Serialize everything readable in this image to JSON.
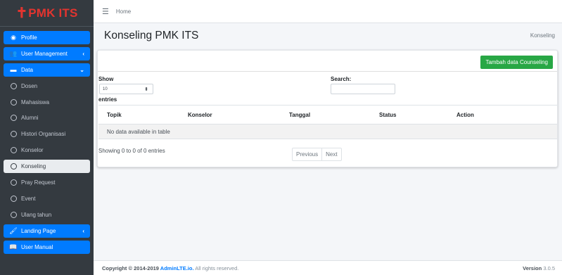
{
  "brand": {
    "cross": "✝",
    "name": "PMK ITS"
  },
  "colors": {
    "brand": "#e3342f",
    "primary": "#007bff",
    "success": "#28a745",
    "sidebar_bg": "#343a40"
  },
  "topbar": {
    "menu_icon": "hamburger-icon",
    "home_link": "Home"
  },
  "sidebar": {
    "items": [
      {
        "label": "Profile",
        "icon": "user-circle-icon",
        "style": "primary"
      },
      {
        "label": "User Management",
        "icon": "users-icon",
        "style": "primary",
        "chevron": "‹"
      },
      {
        "label": "Data",
        "icon": "id-card-icon",
        "style": "primary",
        "chevron": "⌄"
      },
      {
        "label": "Dosen",
        "icon": "circle-icon",
        "style": "dark"
      },
      {
        "label": "Mahasiswa",
        "icon": "circle-icon",
        "style": "dark"
      },
      {
        "label": "Alumni",
        "icon": "circle-icon",
        "style": "dark"
      },
      {
        "label": "Histori Organisasi",
        "icon": "circle-icon",
        "style": "dark"
      },
      {
        "label": "Konselor",
        "icon": "circle-icon",
        "style": "dark"
      },
      {
        "label": "Konseling",
        "icon": "circle-icon",
        "style": "active"
      },
      {
        "label": "Pray Request",
        "icon": "circle-icon",
        "style": "dark"
      },
      {
        "label": "Event",
        "icon": "circle-icon",
        "style": "dark"
      },
      {
        "label": "Ulang tahun",
        "icon": "circle-icon",
        "style": "dark"
      },
      {
        "label": "Landing Page",
        "icon": "paint-brush-icon",
        "style": "primary",
        "chevron": "‹"
      },
      {
        "label": "User Manual",
        "icon": "book-reader-icon",
        "style": "primary"
      }
    ]
  },
  "header": {
    "title": "Konseling PMK ITS",
    "breadcrumb": "Konseling"
  },
  "card": {
    "add_button": "Tambah data Counseling",
    "show_label": "Show",
    "entries_value": "10",
    "entries_label": "entries",
    "search_label": "Search:",
    "search_value": "",
    "table": {
      "columns": [
        "Topik",
        "Konselor",
        "Tanggal",
        "Status",
        "Action"
      ],
      "empty_text": "No data available in table"
    },
    "info": "Showing 0 to 0 of 0 entries",
    "pagination": {
      "previous": "Previous",
      "next": "Next"
    }
  },
  "footer": {
    "copyright_prefix": "Copyright © 2014-2019 ",
    "link": "AdminLTE.io.",
    "copyright_suffix": " All rights reserved.",
    "version_label": "Version",
    "version_value": "3.0.5"
  }
}
